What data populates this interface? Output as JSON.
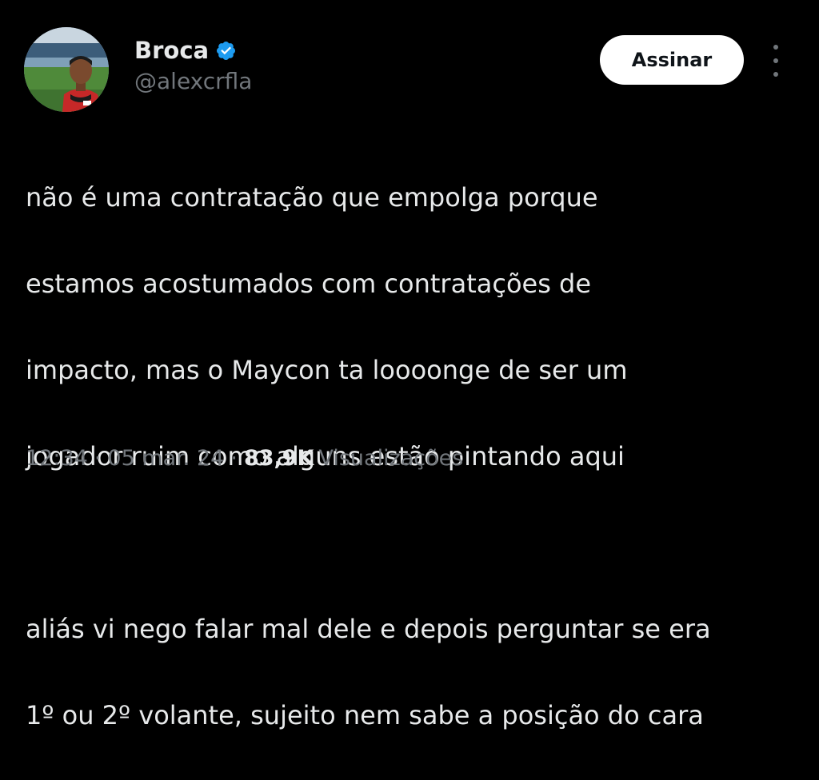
{
  "author": {
    "display_name": "Broca",
    "handle": "@alexcrfla",
    "verified": true
  },
  "follow_button": {
    "label": "Assinar"
  },
  "tweet": {
    "paragraph_1": [
      "não é uma contratação que empolga porque",
      "estamos acostumados com contratações de",
      "impacto, mas o Maycon ta loooonge de ser um",
      "jogador ruim como alguns estão pintando aqui"
    ],
    "paragraph_2": [
      "aliás vi nego falar mal dele e depois perguntar se era",
      "1º ou 2º volante, sujeito nem sabe a posição do cara"
    ]
  },
  "meta": {
    "time": "12:34",
    "separator": "·",
    "date": "05 mar. 24",
    "views_count": "83,9K",
    "views_label": "Visualizações"
  },
  "icons": {
    "verified": "verified-badge-icon",
    "more": "more-options-icon"
  },
  "colors": {
    "background": "#000000",
    "text_primary": "#e7e9ea",
    "text_secondary": "#71767b",
    "verified_blue": "#1d9bf0",
    "button_bg": "#ffffff",
    "button_text": "#0f1419"
  }
}
